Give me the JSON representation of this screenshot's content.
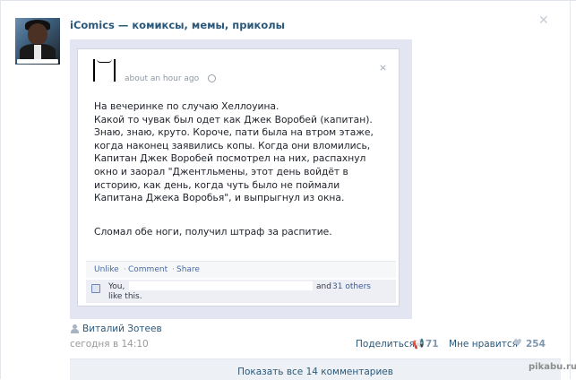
{
  "group": {
    "title": "iComics — комиксы, мемы, приколы"
  },
  "close_symbol": "✕",
  "fb": {
    "time": "about an hour ago",
    "close_symbol": "×",
    "lines": [
      "На вечеринке по случаю Хеллоуина.",
      "Какой то чувак был одет как Джек Воробей (капитан).",
      "Знаю, знаю, круто. Короче, пати была на втром этаже,",
      "когда наконец заявились копы. Когда они вломились,",
      "Капитан Джек Воробей посмотрел на них, распахнул",
      "окно и заорал \"Джентльмены, этот день войдёт в",
      "историю, как день, когда чуть было не поймали",
      "Капитана Джека Воробья\", и выпрыгнул из окна."
    ],
    "last_line": "Сломал обе ноги, получил штраф за распитие.",
    "actions": {
      "unlike": "Unlike",
      "dot": "·",
      "comment": "Comment",
      "share": "Share"
    },
    "likes": {
      "you": "You,",
      "and": "and",
      "others": "31 others",
      "this": "like this."
    }
  },
  "post": {
    "author": "Виталий Зотеев",
    "date": "сегодня в 14:10",
    "share_label": "Поделиться",
    "share_count": "71",
    "like_label": "Мне нравится",
    "like_count": "254",
    "comments_label": "Показать все 14 комментариев"
  },
  "watermark": "pikabu.ru",
  "icons": {
    "author": "person-icon",
    "share": "megaphone-icon",
    "like": "heart-icon"
  },
  "colors": {
    "link": "#2b587a",
    "muted": "#999999",
    "count": "#7f96ad",
    "comments_bg": "#edf1f5"
  }
}
